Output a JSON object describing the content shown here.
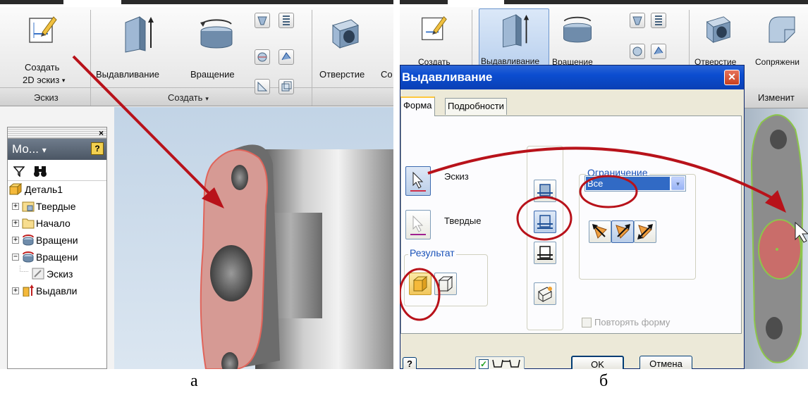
{
  "panel_a": {
    "ribbon": {
      "create_sketch_line1": "Создать",
      "create_sketch_line2": "2D эскиз",
      "create_sketch_arrow": "▾",
      "extrude": "Выдавливание",
      "revolve": "Вращение",
      "hole": "Отверстие",
      "cut_label": "Co",
      "group_sketch": "Эскиз",
      "group_create": "Создать",
      "group_create_arrow": "▾"
    },
    "browser": {
      "close": "×",
      "model_menu": "Мо...",
      "model_menu_arrow": "▾",
      "help": "?",
      "items": [
        {
          "sign": "",
          "label": "Деталь1"
        },
        {
          "sign": "+",
          "label": "Твердые"
        },
        {
          "sign": "+",
          "label": "Начало"
        },
        {
          "sign": "+",
          "label": "Вращени"
        },
        {
          "sign": "−",
          "label": "Вращени"
        },
        {
          "sign": "",
          "label": "Эскиз"
        },
        {
          "sign": "+",
          "label": "Выдавли"
        }
      ]
    }
  },
  "panel_b": {
    "ribbon": {
      "create": "Создать",
      "extrude": "Выдавливание",
      "revolve": "Вращение",
      "hole": "Отверстие",
      "fillet": "Сопряжени",
      "modify": "Изменит"
    },
    "dialog": {
      "title": "Выдавливание",
      "close": "✕",
      "tab_shape": "Форма",
      "tab_details": "Подробности",
      "profile_label": "Эскиз",
      "solids_label": "Твердые",
      "result_legend": "Результат",
      "extents_legend": "Ограничение",
      "extents_value": "Все",
      "combo_arrow": "▾",
      "match_shape": "Повторять форму",
      "ok": "OK",
      "cancel": "Отмена",
      "help": "?",
      "preview_check": "✓"
    }
  },
  "captions": {
    "a": "а",
    "b": "б"
  },
  "colors": {
    "annotation_red": "#b8121a",
    "dialog_title": "#0b4dd0",
    "selection_blue": "#316ac5",
    "profile_pink": "#d98b85"
  }
}
